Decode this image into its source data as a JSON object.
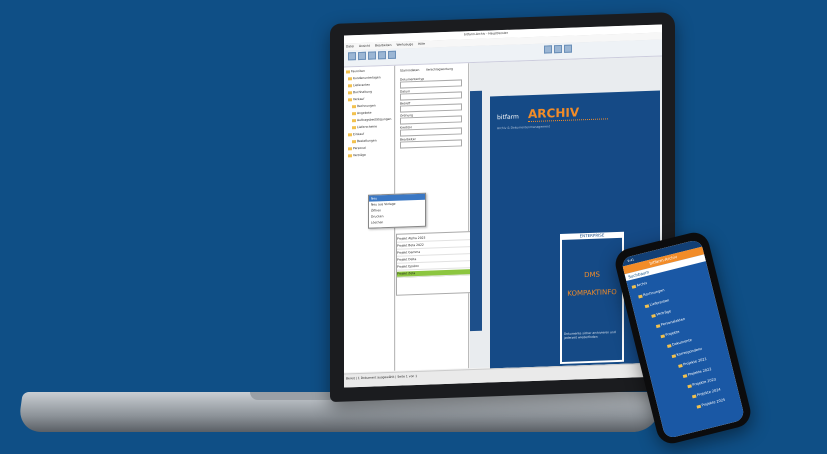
{
  "app": {
    "title": "bitfarm-Archiv - Hauptfenster",
    "menu": [
      "Datei",
      "Ansicht",
      "Bearbeiten",
      "Werkzeuge",
      "Hilfe"
    ],
    "tree": [
      "Favoriten",
      "Kundenunterlagen",
      "Lieferanten",
      "Buchhaltung",
      "Verkauf",
      "Rechnungen",
      "Angebote",
      "Auftragsbestätigungen",
      "Lieferscheine",
      "Einkauf",
      "Bestellungen",
      "Personal",
      "Verträge"
    ],
    "form": {
      "tabs": [
        "Stammdaten",
        "Verschlagwortung"
      ],
      "labels": [
        "Dokumententyp",
        "Datum",
        "Betreff",
        "Ordnung",
        "Kreditor",
        "Bearbeiter"
      ],
      "values": [
        "Eingangsrechnung",
        "25.05.2023",
        "Rechnung",
        "—",
        "Lieferant GmbH",
        "Admin"
      ]
    },
    "context_menu": [
      "Neu",
      "Neu aus Vorlage",
      "Öffnen",
      "Drucken",
      "Löschen"
    ],
    "table": {
      "rows": [
        "Projekt Alpha 2023",
        "Projekt Beta 2022",
        "Projekt Gamma",
        "Projekt Delta",
        "Projekt Epsilon",
        "Projekt Zeta"
      ]
    },
    "status": "Bereit   |   1 Dokument ausgewählt   |   Seite 1 von 1"
  },
  "doc": {
    "brand_small": "bitfarm",
    "brand_big": "ARCHIV",
    "brand_tag": "Archiv & Dokumentenmanagement",
    "card_head": "ENTERPRISE",
    "card_t1": "DMS",
    "card_t2": "KOMPAKTINFO",
    "card_foot": "Dokumente sicher archivieren und jederzeit wiederfinden"
  },
  "phone": {
    "time": "9:41",
    "appbar": "bitfarm-Archiv",
    "head": "Suchbaum",
    "items": [
      "Archiv",
      "Rechnungen",
      "Lieferanten",
      "Verträge",
      "Personalakten",
      "Projekte",
      "Dokumente",
      "Korrespondenz",
      "Projekte 2021",
      "Projekte 2022",
      "Projekte 2023",
      "Projekte 2024",
      "Projekte 2025"
    ]
  },
  "colors": {
    "background": "#0f4f86",
    "accent": "#f28c28",
    "doc": "#154a86"
  }
}
